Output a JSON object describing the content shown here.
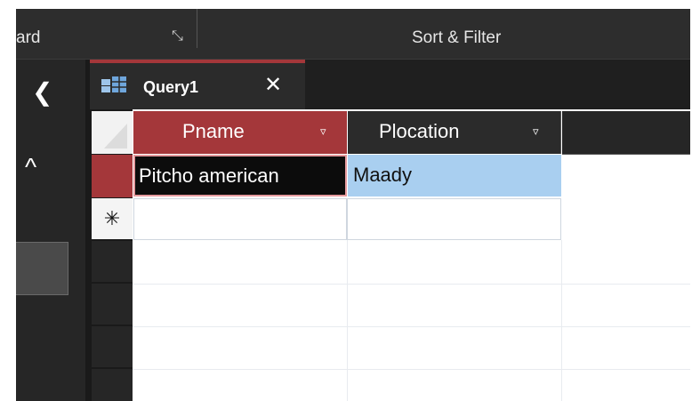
{
  "ribbon": {
    "group_clipboard_label": "ard",
    "launcher_glyph": "⤡",
    "group_sort_label": "Sort & Filter"
  },
  "nav": {
    "collapse_glyph": "❮",
    "expand_glyph": "^"
  },
  "tab": {
    "label": "Query1",
    "close_glyph": "✕",
    "icon": "query-icon"
  },
  "datasheet": {
    "columns": [
      {
        "label": "Pname",
        "sort_glyph": "▿"
      },
      {
        "label": "Plocation",
        "sort_glyph": "▿"
      }
    ],
    "rows": [
      {
        "Pname": "Pitcho american",
        "Plocation": "Maady"
      }
    ],
    "new_record_glyph": "✳"
  },
  "colors": {
    "accent": "#a4373a",
    "selection": "#a9cff0",
    "background": "#262626"
  }
}
